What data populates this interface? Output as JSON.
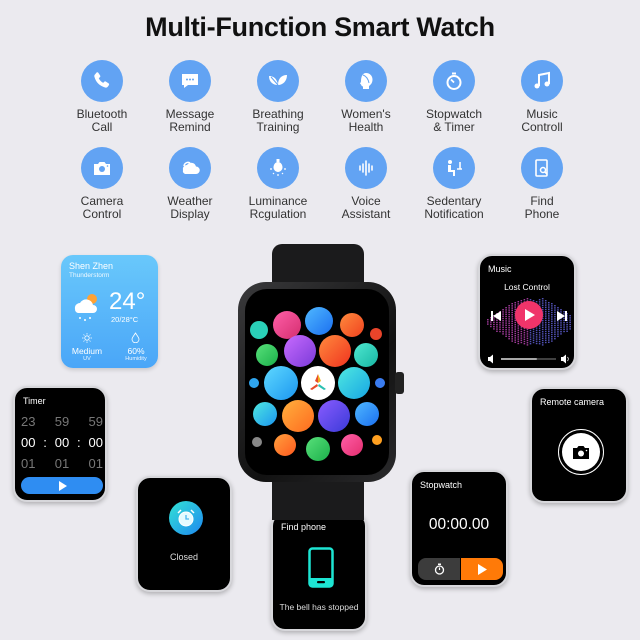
{
  "title": "Multi-Function Smart Watch",
  "accent_color": "#62a3f3",
  "features": [
    {
      "icon": "phone-icon",
      "label": "Bluetooth\nCall"
    },
    {
      "icon": "message-icon",
      "label": "Message\nRemind"
    },
    {
      "icon": "leaf-icon",
      "label": "Breathing\nTraining"
    },
    {
      "icon": "woman-head-icon",
      "label": "Women's\nHealth"
    },
    {
      "icon": "stopwatch-icon",
      "label": "Stopwatch\n& Timer"
    },
    {
      "icon": "music-note-icon",
      "label": "Music\nControll"
    },
    {
      "icon": "camera-icon",
      "label": "Camera\nControl"
    },
    {
      "icon": "cloud-icon",
      "label": "Weather\nDisplay"
    },
    {
      "icon": "bulb-icon",
      "label": "Luminance\nRcgulation"
    },
    {
      "icon": "voice-wave-icon",
      "label": "Voice\nAssistant"
    },
    {
      "icon": "sitting-person-icon",
      "label": "Sedentary\nNotification"
    },
    {
      "icon": "find-phone-icon",
      "label": "Find\nPhone"
    }
  ],
  "weather": {
    "city": "Shen Zhen",
    "condition": "Thunderstorm",
    "temperature": "24°",
    "range": "20/28°C",
    "uv_value": "Medium",
    "uv_label": "UV",
    "humidity_value": "60%",
    "humidity_label": "Humidity"
  },
  "timer": {
    "title": "Timer",
    "prev": [
      "23",
      "59",
      "59"
    ],
    "current": [
      "00",
      ":",
      "00",
      ":",
      "00"
    ],
    "next": [
      "01",
      "01",
      "01"
    ],
    "button_color": "#2f8df2"
  },
  "music": {
    "title": "Music",
    "song": "Lost Control",
    "volume_fraction": 0.65,
    "play_color": "#f0346a"
  },
  "remote_camera": {
    "title": "Remote camera"
  },
  "alarm": {
    "status": "Closed"
  },
  "find_phone": {
    "title": "Find phone",
    "message": "The bell has stopped",
    "icon_color": "#1de5d3"
  },
  "stopwatch": {
    "title": "Stopwatch",
    "time": "00:00.00",
    "start_color": "#ff7a08"
  }
}
